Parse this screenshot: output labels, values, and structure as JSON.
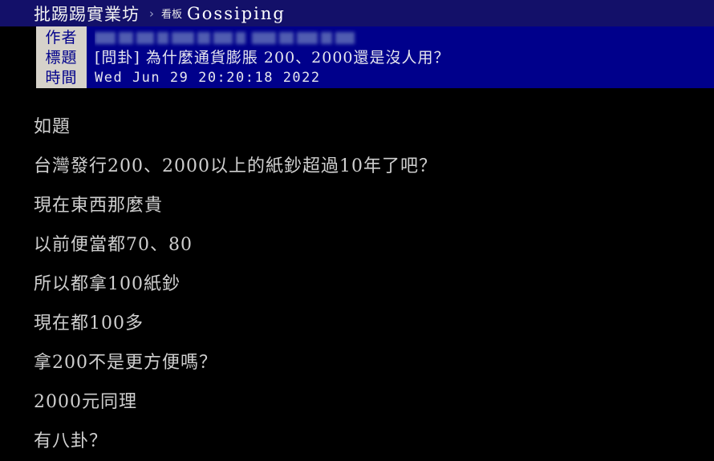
{
  "topbar": {
    "site_name": "批踢踢實業坊",
    "separator": "›",
    "board_prefix": "看板",
    "board_name": "Gossiping",
    "background_color": "#131069"
  },
  "article_header": {
    "background_color": "#00008b",
    "label_background_color": "#d6d2ca",
    "label_text_color": "#00008b",
    "labels": {
      "author": "作者",
      "title": "標題",
      "time": "時間"
    },
    "values": {
      "author": "",
      "author_censored": true,
      "title": "[問卦] 為什麼通貨膨脹 200、2000還是沒人用？",
      "time": "Wed Jun 29 20:20:18 2022"
    }
  },
  "body": {
    "background_color": "#000000",
    "text_color": "#cfcfcf",
    "paragraphs": [
      "如題",
      "台灣發行200、2000以上的紙鈔超過10年了吧？",
      "現在東西那麼貴",
      "以前便當都70、80",
      "所以都拿100紙鈔",
      "現在都100多",
      "拿200不是更方便嗎？",
      "2000元同理",
      "有八卦？"
    ]
  }
}
